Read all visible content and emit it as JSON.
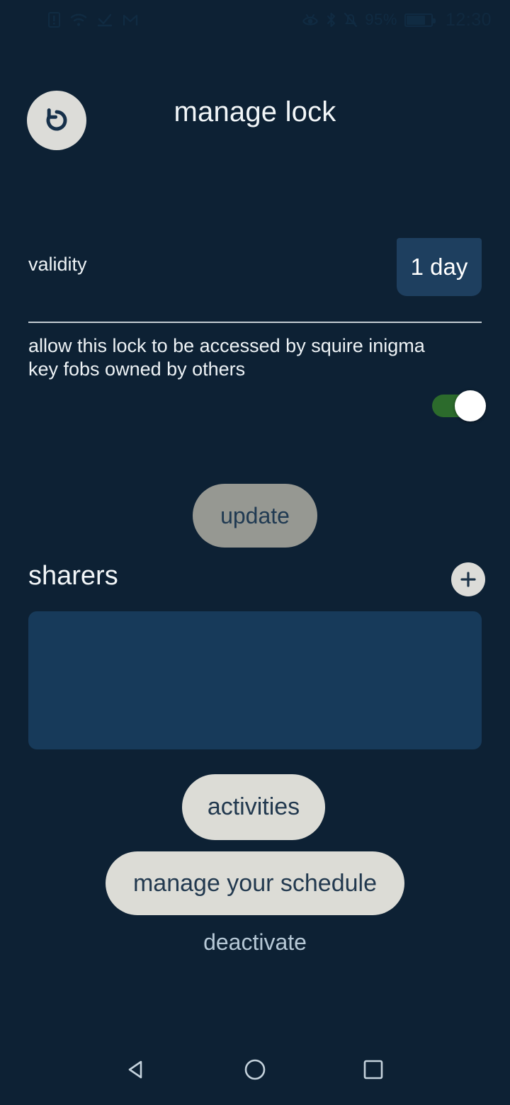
{
  "status_bar": {
    "left_icons": [
      {
        "name": "sim-card-icon",
        "glyph": "document"
      },
      {
        "name": "wifi-icon",
        "glyph": "wifi"
      },
      {
        "name": "download-complete-icon",
        "glyph": "check-arrow"
      },
      {
        "name": "gmail-icon",
        "glyph": "M"
      }
    ],
    "right_icons": [
      {
        "name": "eye-comfort-icon",
        "glyph": "eye"
      },
      {
        "name": "bluetooth-icon",
        "glyph": "bluetooth"
      },
      {
        "name": "silent-mode-icon",
        "glyph": "bell-off"
      }
    ],
    "battery_percent": "95%",
    "clock": "12:30"
  },
  "header": {
    "back_icon": "undo-rotate-icon",
    "title": "manage lock"
  },
  "validity": {
    "label": "validity",
    "value": "1 day",
    "options": [
      "1 day"
    ]
  },
  "sharing": {
    "description": "allow this lock to be accessed by squire inigma key fobs owned by others",
    "toggle_state": "on"
  },
  "update": {
    "label": "update",
    "enabled": false
  },
  "sharers": {
    "title": "sharers",
    "add_icon": "plus-icon",
    "items": [],
    "empty_text": ""
  },
  "actions": {
    "activities_label": "activities",
    "schedule_label": "manage your schedule",
    "deactivate_label": "deactivate"
  },
  "nav_bar": {
    "back": "back-triangle-icon",
    "home": "home-circle-icon",
    "recents": "recents-square-icon"
  },
  "colors": {
    "background": "#0d2134",
    "select_blue": "#1e3f5f",
    "panel_blue": "#173a5a",
    "toggle_green": "#2c6b2c",
    "pill_gray": "#dcdcd6",
    "update_gray": "#969892",
    "text_light": "#eef3f6",
    "deactivate": "#b6c8d6"
  }
}
